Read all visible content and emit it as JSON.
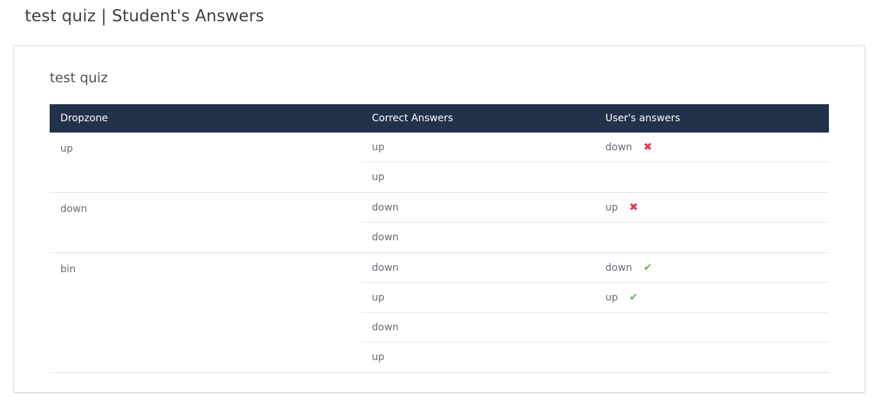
{
  "page_title": "test quiz | Student's Answers",
  "card": {
    "quiz_title": "test quiz"
  },
  "table": {
    "headers": [
      "Dropzone",
      "Correct Answers",
      "User's answers"
    ],
    "groups": [
      {
        "dropzone": "up",
        "rows": [
          {
            "correct": "up",
            "user": "down",
            "status": "wrong"
          },
          {
            "correct": "up",
            "user": "",
            "status": ""
          }
        ]
      },
      {
        "dropzone": "down",
        "rows": [
          {
            "correct": "down",
            "user": "up",
            "status": "wrong"
          },
          {
            "correct": "down",
            "user": "",
            "status": ""
          }
        ]
      },
      {
        "dropzone": "bin",
        "rows": [
          {
            "correct": "down",
            "user": "down",
            "status": "correct"
          },
          {
            "correct": "up",
            "user": "up",
            "status": "correct"
          },
          {
            "correct": "down",
            "user": "",
            "status": ""
          },
          {
            "correct": "up",
            "user": "",
            "status": ""
          }
        ]
      }
    ]
  },
  "icons": {
    "wrong": "cross-icon",
    "correct": "check-icon"
  },
  "colors": {
    "header_bg": "#22324a",
    "wrong": "#e03a56",
    "correct": "#6cbf4f"
  }
}
